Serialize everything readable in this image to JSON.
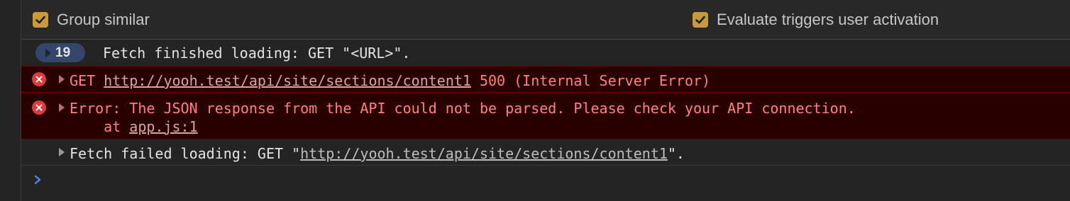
{
  "toolbar": {
    "group_similar": {
      "label": "Group similar",
      "checked": true
    },
    "evaluate_triggers": {
      "label": "Evaluate triggers user activation",
      "checked": true
    }
  },
  "messages": [
    {
      "type": "group",
      "count": "19",
      "text": "Fetch finished loading: GET \"<URL>\"."
    },
    {
      "type": "error",
      "prefix": "GET ",
      "link": "http://yooh.test/api/site/sections/content1",
      "suffix": " 500 (Internal Server Error)"
    },
    {
      "type": "error",
      "text": "Error: The JSON response from the API could not be parsed. Please check your API connection.",
      "at": "    at ",
      "source": "app.js:1"
    },
    {
      "type": "log",
      "prefix": "Fetch failed loading: GET \"",
      "link": "http://yooh.test/api/site/sections/content1",
      "suffix": "\"."
    }
  ],
  "colors": {
    "error_bg": "#290000",
    "error_text": "#ff8080",
    "checkbox": "#c99a3a",
    "badge": "#34466b",
    "prompt": "#4e8cf0"
  },
  "icons": {
    "checkbox": "checkmark-icon",
    "error": "error-x-icon",
    "expand": "triangle-right-icon",
    "prompt": "chevron-right-icon"
  }
}
